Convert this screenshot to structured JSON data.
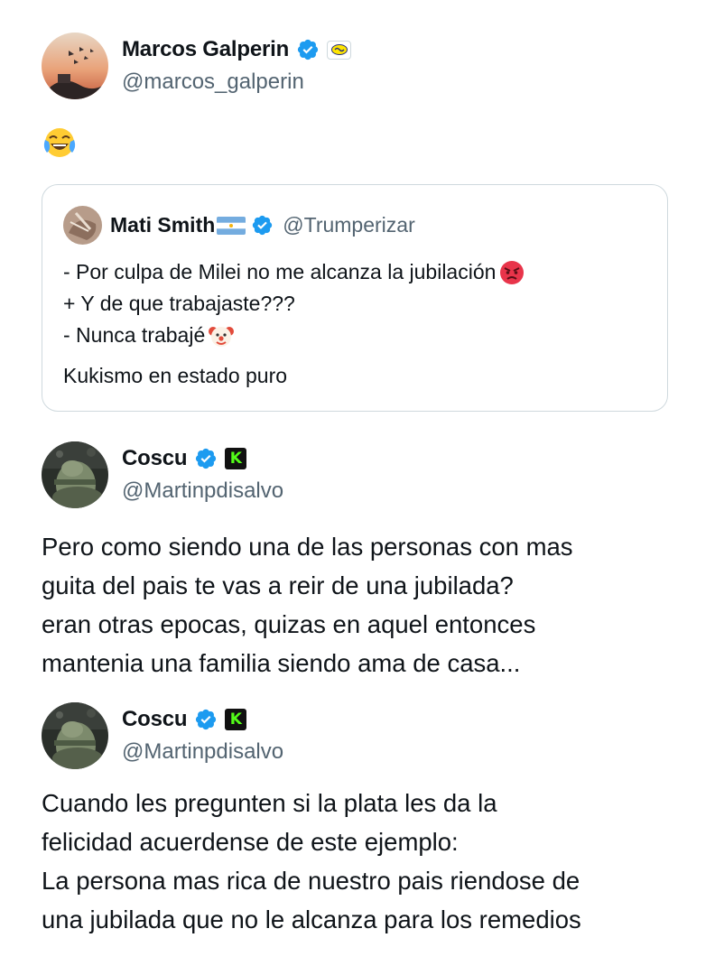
{
  "tweet1": {
    "name": "Marcos Galperin",
    "handle": "@marcos_galperin",
    "icon": "laughing-crying-emoji"
  },
  "quote": {
    "name": "Mati Smith",
    "handle": "@Trumperizar",
    "line1": "- Por culpa de Milei no me alcanza la jubilación",
    "line2": "+ Y de que trabajaste???",
    "line3": "- Nunca trabajé",
    "footer": "Kukismo en estado puro"
  },
  "reply1": {
    "name": "Coscu",
    "handle": "@Martinpdisalvo",
    "kick_letter": "K",
    "lines": [
      "Pero como siendo una de las personas con mas",
      "guita del pais te vas a reir de una jubilada?",
      "eran otras epocas, quizas en aquel entonces",
      "mantenia una familia siendo ama de casa..."
    ]
  },
  "reply2": {
    "name": "Coscu",
    "handle": "@Martinpdisalvo",
    "kick_letter": "K",
    "lines": [
      "Cuando les pregunten si la plata les da la",
      "felicidad acuerdense de este ejemplo:",
      "La persona mas rica de nuestro pais riendose de",
      "una jubilada que no le alcanza para los remedios"
    ]
  },
  "colors": {
    "verified": "#1d9bf0",
    "kick": "#53fc18",
    "secondary_text": "#536471"
  }
}
